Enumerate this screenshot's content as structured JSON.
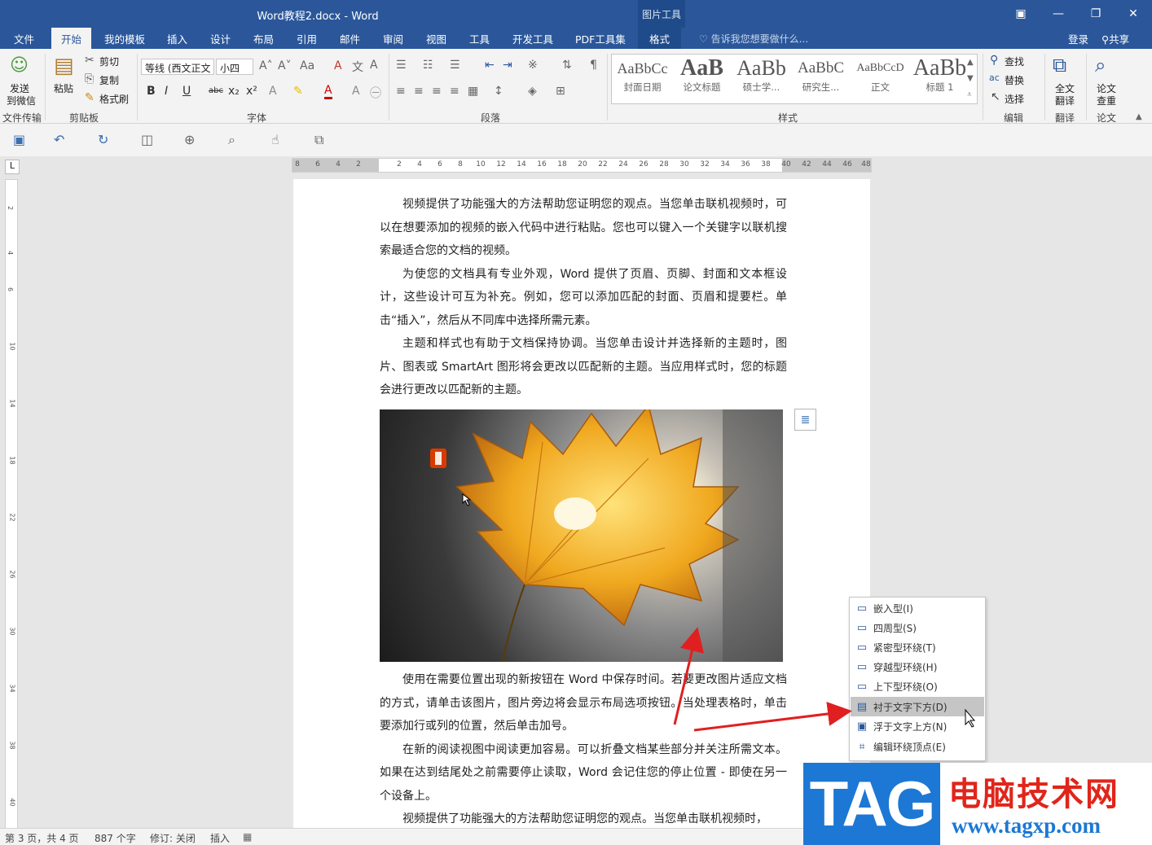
{
  "window": {
    "title": "Word教程2.docx - Word",
    "context_tools": "图片工具",
    "min": "—",
    "restore": "❐",
    "close": "✕",
    "ribbon_display": "▣"
  },
  "tabs": [
    {
      "label": "文件"
    },
    {
      "label": "开始"
    },
    {
      "label": "我的模板"
    },
    {
      "label": "插入"
    },
    {
      "label": "设计"
    },
    {
      "label": "布局"
    },
    {
      "label": "引用"
    },
    {
      "label": "邮件"
    },
    {
      "label": "审阅"
    },
    {
      "label": "视图"
    },
    {
      "label": "工具"
    },
    {
      "label": "开发工具"
    },
    {
      "label": "PDF工具集"
    },
    {
      "label": "格式"
    }
  ],
  "tell_me": "告诉我您想要做什么...",
  "login": "登录",
  "share": "共享",
  "ribbon": {
    "send": [
      "发送",
      "到微信"
    ],
    "paste": "粘贴",
    "cut": "剪切",
    "copy": "复制",
    "format_painter": "格式刷",
    "font_name": "等线 (西文正文",
    "font_size": "小四",
    "find": "查找",
    "replace": "替换",
    "select": "选择",
    "translate": [
      "全文",
      "翻译"
    ],
    "check": [
      "论文",
      "查重"
    ],
    "groups": {
      "file_transfer": "文件传输",
      "clipboard": "剪贴板",
      "font": "字体",
      "paragraph": "段落",
      "styles": "样式",
      "edit": "编辑",
      "translate": "翻译",
      "paper": "论文"
    },
    "styles": [
      {
        "preview": "AaBbCc",
        "name": "封面日期"
      },
      {
        "preview": "AaB",
        "name": "论文标题"
      },
      {
        "preview": "AaBb",
        "name": "硕士学..."
      },
      {
        "preview": "AaBbC",
        "name": "研究生..."
      },
      {
        "preview": "AaBbCcD",
        "name": "正文"
      },
      {
        "preview": "AaBb",
        "name": "标题 1"
      }
    ]
  },
  "ruler_h": [
    "8",
    "6",
    "4",
    "2",
    "",
    "2",
    "4",
    "6",
    "8",
    "10",
    "12",
    "14",
    "16",
    "18",
    "20",
    "22",
    "24",
    "26",
    "28",
    "30",
    "32",
    "34",
    "36",
    "38",
    "40",
    "42",
    "44",
    "46",
    "48"
  ],
  "ruler_v": [
    "1",
    "2",
    "1",
    "4",
    "1",
    "6",
    "1",
    "8",
    "10",
    "12",
    "14",
    "16",
    "18",
    "20",
    "22",
    "24",
    "26",
    "28",
    "30",
    "32",
    "34",
    "36",
    "38",
    "40"
  ],
  "document": {
    "paragraphs_top": [
      "视频提供了功能强大的方法帮助您证明您的观点。当您单击联机视频时，可以在想要添加的视频的嵌入代码中进行粘贴。您也可以键入一个关键字以联机搜索最适合您的文档的视频。",
      "为使您的文档具有专业外观，Word 提供了页眉、页脚、封面和文本框设计，这些设计可互为补充。例如，您可以添加匹配的封面、页眉和提要栏。单击“插入”，然后从不同库中选择所需元素。",
      "主题和样式也有助于文档保持协调。当您单击设计并选择新的主题时，图片、图表或 SmartArt 图形将会更改以匹配新的主题。当应用样式时，您的标题会进行更改以匹配新的主题。"
    ],
    "paragraphs_bottom": [
      "使用在需要位置出现的新按钮在 Word 中保存时间。若要更改图片适应文档的方式，请单击该图片，图片旁边将会显示布局选项按钮。当处理表格时，单击要添加行或列的位置，然后单击加号。",
      "在新的阅读视图中阅读更加容易。可以折叠文档某些部分并关注所需文本。如果在达到结尾处之前需要停止读取，Word 会记住您的停止位置 - 即使在另一个设备上。",
      "视频提供了功能强大的方法帮助您证明您的观点。当您单击联机视频时，"
    ]
  },
  "context_menu": [
    {
      "label": "嵌入型(I)",
      "icon": "inline-icon"
    },
    {
      "label": "四周型(S)",
      "icon": "square-wrap-icon"
    },
    {
      "label": "紧密型环绕(T)",
      "icon": "tight-wrap-icon"
    },
    {
      "label": "穿越型环绕(H)",
      "icon": "through-wrap-icon"
    },
    {
      "label": "上下型环绕(O)",
      "icon": "top-bottom-wrap-icon"
    },
    {
      "label": "衬于文字下方(D)",
      "icon": "behind-text-icon",
      "selected": true
    },
    {
      "label": "浮于文字上方(N)",
      "icon": "in-front-text-icon"
    },
    {
      "label": "编辑环绕顶点(E)",
      "icon": "edit-wrap-points-icon"
    }
  ],
  "status": {
    "page": "第 3 页，共 4 页",
    "words": "887 个字",
    "track": "修订: 关闭",
    "mode": "插入"
  },
  "watermark": {
    "tag": "TAG",
    "site_name": "电脑技术网",
    "url": "www.tagxp.com"
  },
  "colors": {
    "brand": "#2b579a",
    "arrow": "#e02020",
    "watermark_red": "#e0251b",
    "watermark_blue": "#1c78d4"
  }
}
